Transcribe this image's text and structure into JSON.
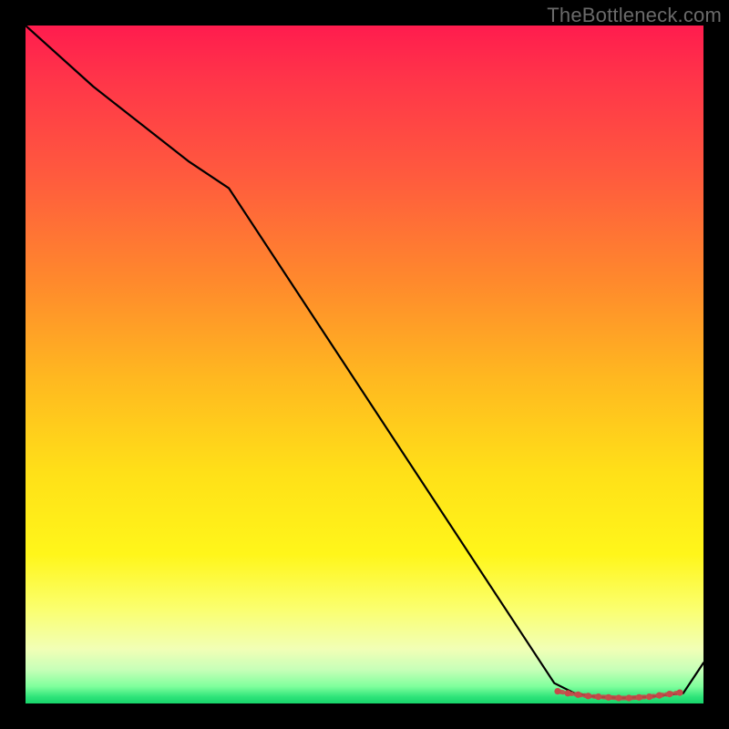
{
  "watermark": "TheBottleneck.com",
  "chart_data": {
    "type": "line",
    "title": "",
    "xlabel": "",
    "ylabel": "",
    "xlim": [
      0,
      100
    ],
    "ylim": [
      0,
      100
    ],
    "grid": false,
    "series": [
      {
        "name": "curve",
        "color": "#000000",
        "x": [
          0,
          10,
          24,
          30,
          78,
          81,
          84,
          88,
          92,
          97,
          100
        ],
        "y": [
          100,
          91,
          80,
          76,
          3,
          1.5,
          1.0,
          0.8,
          1.0,
          1.5,
          6
        ]
      }
    ],
    "markers": {
      "name": "flat-segment-dots",
      "color": "#c64a4a",
      "x": [
        78.5,
        80,
        81.5,
        83,
        84.5,
        86,
        87.5,
        89,
        90.5,
        92,
        93.5,
        95,
        96.5
      ],
      "y": [
        1.8,
        1.5,
        1.3,
        1.1,
        1.0,
        0.9,
        0.8,
        0.8,
        0.9,
        1.0,
        1.2,
        1.4,
        1.6
      ]
    },
    "gradient_stops": [
      {
        "pos": 0.0,
        "color": "#ff1c4e"
      },
      {
        "pos": 0.08,
        "color": "#ff3549"
      },
      {
        "pos": 0.22,
        "color": "#ff5a3e"
      },
      {
        "pos": 0.38,
        "color": "#ff8a2c"
      },
      {
        "pos": 0.52,
        "color": "#ffb820"
      },
      {
        "pos": 0.66,
        "color": "#ffe018"
      },
      {
        "pos": 0.78,
        "color": "#fff61a"
      },
      {
        "pos": 0.86,
        "color": "#fbff6e"
      },
      {
        "pos": 0.92,
        "color": "#f1ffb6"
      },
      {
        "pos": 0.95,
        "color": "#c7ffb8"
      },
      {
        "pos": 0.975,
        "color": "#7fff9c"
      },
      {
        "pos": 0.99,
        "color": "#2fe47a"
      },
      {
        "pos": 1.0,
        "color": "#17d46a"
      }
    ]
  }
}
